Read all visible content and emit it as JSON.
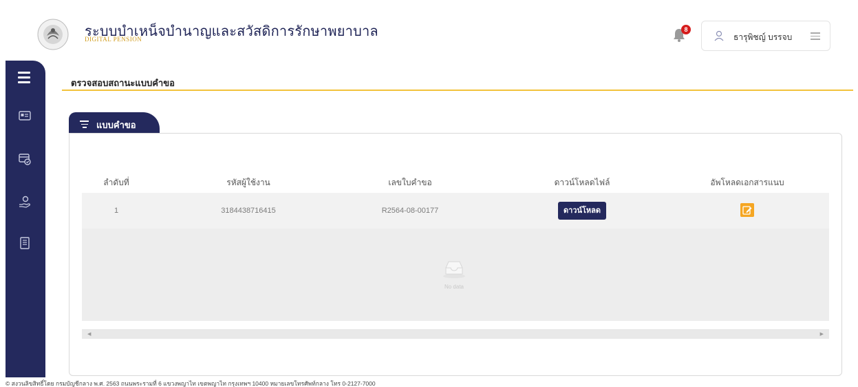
{
  "header": {
    "title": "ระบบบำเหน็จบำนาญและสวัสดิการรักษาพยาบาล",
    "subtitle": "DIGITAL PENSION",
    "notification_count": "8",
    "user_name": "ธารุพิชญ์ บรรจบ"
  },
  "page": {
    "title": "ตรวจสอบสถานะแบบคำขอ",
    "tab_label": "แบบคำขอ"
  },
  "table": {
    "columns": [
      "ลำดับที่",
      "รหัสผู้ใช้งาน",
      "เลขใบคำขอ",
      "ดาวน์โหลดไฟล์",
      "อัพโหลดเอกสารแนบ"
    ],
    "rows": [
      {
        "index": "1",
        "user_id": "3184438716415",
        "request_no": "R2564-08-00177",
        "download_label": "ดาวน์โหลด"
      }
    ],
    "empty_text": "No data"
  },
  "footer": {
    "text": "© สงวนลิขสิทธิ์โดย กรมบัญชีกลาง พ.ศ. 2563 ถนนพระรามที่ 6 แขวงพญาไท เขตพญาไท กรุงเทพฯ 10400 หมายเลขโทรศัพท์กลาง โทร 0-2127-7000"
  },
  "colors": {
    "primary": "#24295d",
    "accent_line": "#f2c23a",
    "edit_button": "#f5a623",
    "badge": "#d61c1c"
  }
}
